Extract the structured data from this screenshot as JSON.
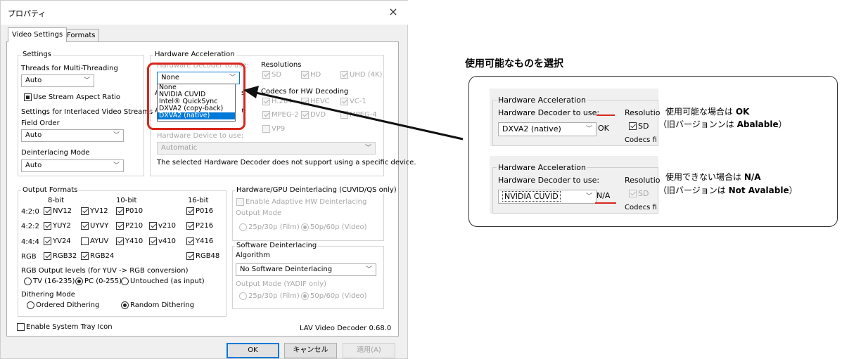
{
  "dialog": {
    "title": "プロパティ",
    "close": "×",
    "tabs": [
      "Video Settings",
      "Formats"
    ],
    "settings": {
      "group": "Settings",
      "threads_label": "Threads for Multi-Threading",
      "threads_value": "Auto",
      "stream_aspect": "Use Stream Aspect Ratio",
      "interlaced_label": "Settings for Interlaced Video Streams",
      "field_order_label": "Field Order",
      "field_order_value": "Auto",
      "deint_mode_label": "Deinterlacing Mode",
      "deint_mode_value": "Auto"
    },
    "hw": {
      "group": "Hardware Acceleration",
      "decoder_label": "Hardware Decoder to use:",
      "decoder_value": "None",
      "dropdown_options": [
        "None",
        "NVIDIA CUVID",
        "Intel® QuickSync",
        "DXVA2 (copy-back)",
        "DXVA2 (native)"
      ],
      "resolutions_label": "Resolutions",
      "res_sd": "SD",
      "res_hd": "HD",
      "res_uhd": "UHD (4K)",
      "codecs_label": "Codecs for HW Decoding",
      "codec_h264": "H.264",
      "codec_hevc": "HEVC",
      "codec_vc1": "VC-1",
      "codec_mpeg2": "MPEG-2",
      "codec_dvd": "DVD",
      "codec_mpeg4": "MPEG-4",
      "codec_vp9": "VP9",
      "device_label": "Hardware Device to use:",
      "device_value": "Automatic",
      "device_note": "The selected Hardware Decoder does not support using a specific device.",
      "partial_a": "A",
      "partial_a2": "A",
      "partial_s": "s",
      "partial_r": "r:"
    },
    "output": {
      "group": "Output Formats",
      "col_8bit": "8-bit",
      "col_10bit": "10-bit",
      "col_16bit": "16-bit",
      "row_420": "4:2:0",
      "row_422": "4:2:2",
      "row_444": "4:4:4",
      "row_rgb": "RGB",
      "nv12": "NV12",
      "yv12": "YV12",
      "p010": "P010",
      "p016": "P016",
      "yuy2": "YUY2",
      "uyvy": "UYVY",
      "p210": "P210",
      "v210": "v210",
      "p216": "P216",
      "yv24": "YV24",
      "ayuv": "AYUV",
      "y410": "Y410",
      "v410": "v410",
      "y416": "Y416",
      "rgb32": "RGB32",
      "rgb24": "RGB24",
      "rgb48": "RGB48",
      "levels_label": "RGB Output levels (for YUV -> RGB conversion)",
      "tv": "TV (16-235)",
      "pc": "PC (0-255)",
      "untouched": "Untouched (as input)",
      "dither_label": "Dithering Mode",
      "ordered": "Ordered Dithering",
      "random": "Random Dithering"
    },
    "hw_deint": {
      "group": "Hardware/GPU Deinterlacing (CUVID/QS only)",
      "adaptive": "Enable Adaptive HW Deinterlacing",
      "output_mode": "Output Mode",
      "film": "25p/30p (Film)",
      "video": "50p/60p (Video)"
    },
    "sw_deint": {
      "group": "Software Deinterlacing",
      "algorithm_label": "Algorithm",
      "algorithm_value": "No Software Deinterlacing",
      "output_mode": "Output Mode (YADIF only)",
      "film": "25p/30p (Film)",
      "video": "50p/60p (Video)"
    },
    "tray": "Enable System Tray Icon",
    "version": "LAV Video Decoder 0.68.0",
    "ok": "OK",
    "cancel": "キャンセル",
    "apply": "適用(A)"
  },
  "annotation": {
    "heading": "使用可能なものを選択",
    "snip1": {
      "group": "Hardware Acceleration",
      "label": "Hardware Decoder to use:",
      "value": "DXVA2 (native)",
      "status": "OK",
      "res": "Resolutio",
      "sd": "SD",
      "codecs": "Codecs fi"
    },
    "snip2": {
      "group": "Hardware Acceleration",
      "label": "Hardware Decoder to use:",
      "value": "NVIDIA CUVID",
      "status": "N/A",
      "res": "Resolutio",
      "sd": "SD",
      "codecs": "Codecs fi"
    },
    "note1_pre": "使用可能な場合は ",
    "note1_bold": "OK",
    "note1b_pre": "（旧バージョンンは ",
    "note1b_bold": "Abalable",
    "note1b_post": "）",
    "note2_pre": "使用できない場合は ",
    "note2_bold": "N/A",
    "note2b_pre": "（旧バージョンは ",
    "note2b_bold": "Not Avalable",
    "note2b_post": "）"
  },
  "colors": {
    "highlight": "#d9261c",
    "selection": "#0078d7"
  }
}
